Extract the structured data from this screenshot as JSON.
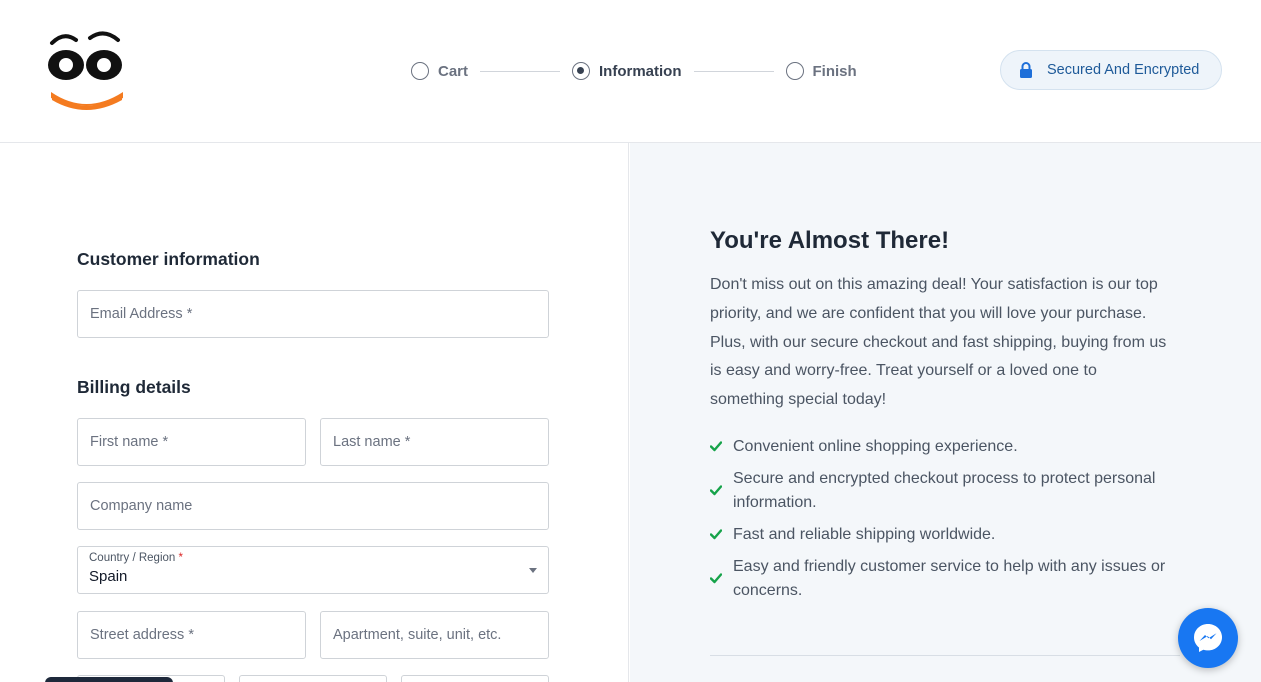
{
  "header": {
    "logo_icon": "smiley-face-logo",
    "steps": [
      {
        "label": "Cart",
        "state": "inactive"
      },
      {
        "label": "Information",
        "state": "active"
      },
      {
        "label": "Finish",
        "state": "inactive"
      }
    ],
    "secure_badge": {
      "icon": "lock-icon",
      "label": "Secured And Encrypted"
    }
  },
  "form": {
    "customer_title": "Customer information",
    "email_placeholder": "Email Address *",
    "billing_title": "Billing details",
    "first_name_placeholder": "First name *",
    "last_name_placeholder": "Last name *",
    "company_placeholder": "Company name",
    "country": {
      "label": "Country / Region",
      "required_mark": "*",
      "value": "Spain"
    },
    "street_placeholder": "Street address *",
    "apartment_placeholder": "Apartment, suite, unit, etc."
  },
  "sidebar": {
    "title": "You're Almost There!",
    "text": "Don't miss out on this amazing deal! Your satisfaction is our top priority, and we are confident that you will love your purchase. Plus, with our secure checkout and fast shipping, buying from us is easy and worry-free. Treat yourself or a loved one to something special today!",
    "benefits": [
      "Convenient online shopping experience.",
      "Secure and encrypted checkout process to protect personal information.",
      "Fast and reliable shipping worldwide.",
      "Easy and friendly customer service to help with any issues or concerns."
    ]
  },
  "colors": {
    "accent_blue": "#1e5a99",
    "check_green": "#16a34a",
    "messenger_blue": "#1877f2",
    "logo_orange": "#f47b20"
  },
  "chat_widget": {
    "icon": "messenger-icon"
  }
}
